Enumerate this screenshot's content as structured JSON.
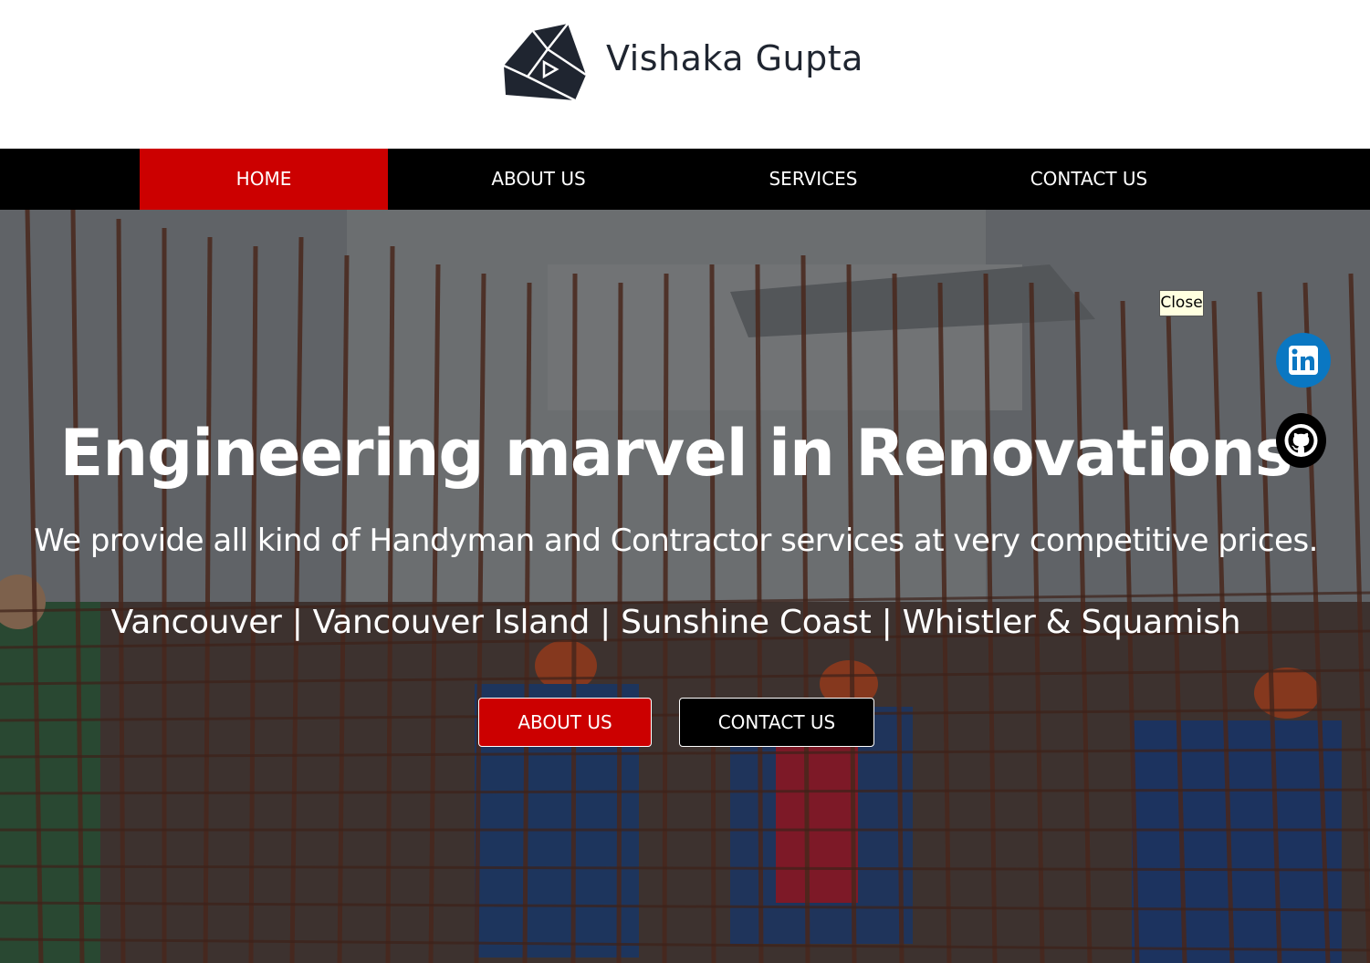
{
  "brand": {
    "name": "Vishaka Gupta",
    "logo_icon": "triangle-play-logo"
  },
  "nav": {
    "items": [
      {
        "label": "HOME",
        "active": true
      },
      {
        "label": "ABOUT US",
        "active": false
      },
      {
        "label": "SERVICES",
        "active": false
      },
      {
        "label": "CONTACT US",
        "active": false
      }
    ]
  },
  "hero": {
    "title": "Engineering marvel in Renovations",
    "subtitle": "We provide all kind of Handyman and Contractor services at very competitive prices.",
    "locations": "Vancouver | Vancouver Island | Sunshine Coast | Whistler & Squamish",
    "buttons": {
      "about": "ABOUT US",
      "contact": "CONTACT US"
    }
  },
  "popup": {
    "close_label": "Close"
  },
  "social": {
    "linkedin_icon": "linkedin-icon",
    "github_icon": "github-icon"
  },
  "colors": {
    "accent": "#cc0000",
    "nav_bg": "#000000",
    "linkedin": "#0a77c2"
  }
}
